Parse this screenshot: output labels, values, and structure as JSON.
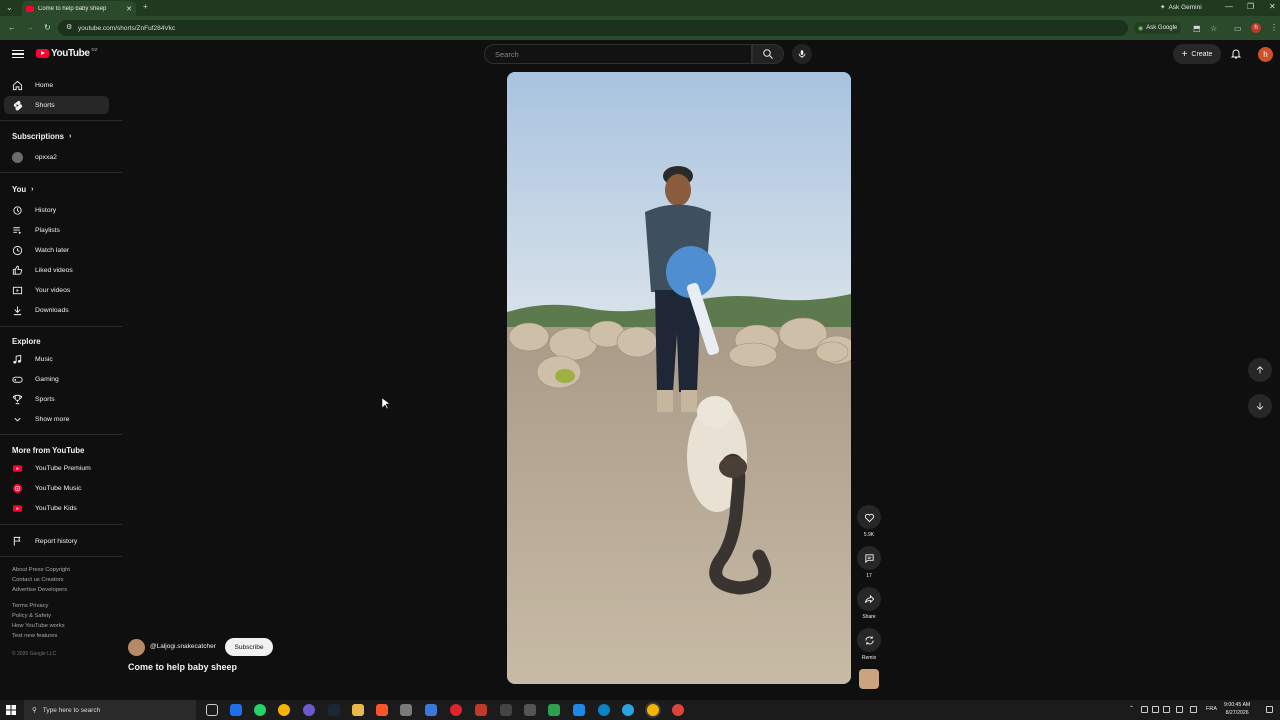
{
  "browser": {
    "tab_title": "Come to help baby sheep",
    "url": "youtube.com/shorts/ZnFuf284Vkc",
    "ask_google": "Ask Google",
    "ask_gemini": "Ask Gemini",
    "profile_initial": "h"
  },
  "masthead": {
    "logo_text": "YouTube",
    "country_code": "DZ",
    "search_placeholder": "Search",
    "create_label": "Create",
    "avatar_initial": "h"
  },
  "sidebar": {
    "main": [
      {
        "label": "Home",
        "icon": "home-icon"
      },
      {
        "label": "Shorts",
        "icon": "shorts-icon",
        "active": true
      }
    ],
    "subscriptions_heading": "Subscriptions",
    "subscriptions": [
      {
        "label": "opxxa2"
      }
    ],
    "you_heading": "You",
    "you": [
      {
        "label": "History",
        "icon": "history-icon"
      },
      {
        "label": "Playlists",
        "icon": "playlists-icon"
      },
      {
        "label": "Watch later",
        "icon": "watch-later-icon"
      },
      {
        "label": "Liked videos",
        "icon": "like-icon"
      },
      {
        "label": "Your videos",
        "icon": "your-videos-icon"
      },
      {
        "label": "Downloads",
        "icon": "download-icon"
      }
    ],
    "explore_heading": "Explore",
    "explore": [
      {
        "label": "Music",
        "icon": "music-icon"
      },
      {
        "label": "Gaming",
        "icon": "gaming-icon"
      },
      {
        "label": "Sports",
        "icon": "trophy-icon"
      },
      {
        "label": "Show more",
        "icon": "chevron-down-icon"
      }
    ],
    "more_heading": "More from YouTube",
    "more": [
      {
        "label": "YouTube Premium"
      },
      {
        "label": "YouTube Music"
      },
      {
        "label": "YouTube Kids"
      }
    ],
    "report_history": "Report history",
    "footer_links_1": "About  Press  Copyright",
    "footer_links_2": "Contact us  Creators",
    "footer_links_3": "Advertise  Developers",
    "footer_links_4": "Terms  Privacy",
    "footer_links_5": "Policy & Safety",
    "footer_links_6": "How YouTube works",
    "footer_links_7": "Test new features",
    "copyright": "© 2026 Google LLC"
  },
  "short": {
    "channel": "@Laljogi.snakecatcher",
    "subscribe": "Subscribe",
    "title": "Come to help baby sheep",
    "likes": "5.9K",
    "comments": "17",
    "share": "Share",
    "remix": "Remix"
  },
  "taskbar": {
    "search_placeholder": "Type here to search",
    "lang": "FRA",
    "time": "9:00:45 AM",
    "date": "8/27/2026"
  },
  "colors": {
    "background": "#0f0f0f",
    "youtube_red": "#ff0033",
    "browser_green": "#2b4a2b"
  }
}
